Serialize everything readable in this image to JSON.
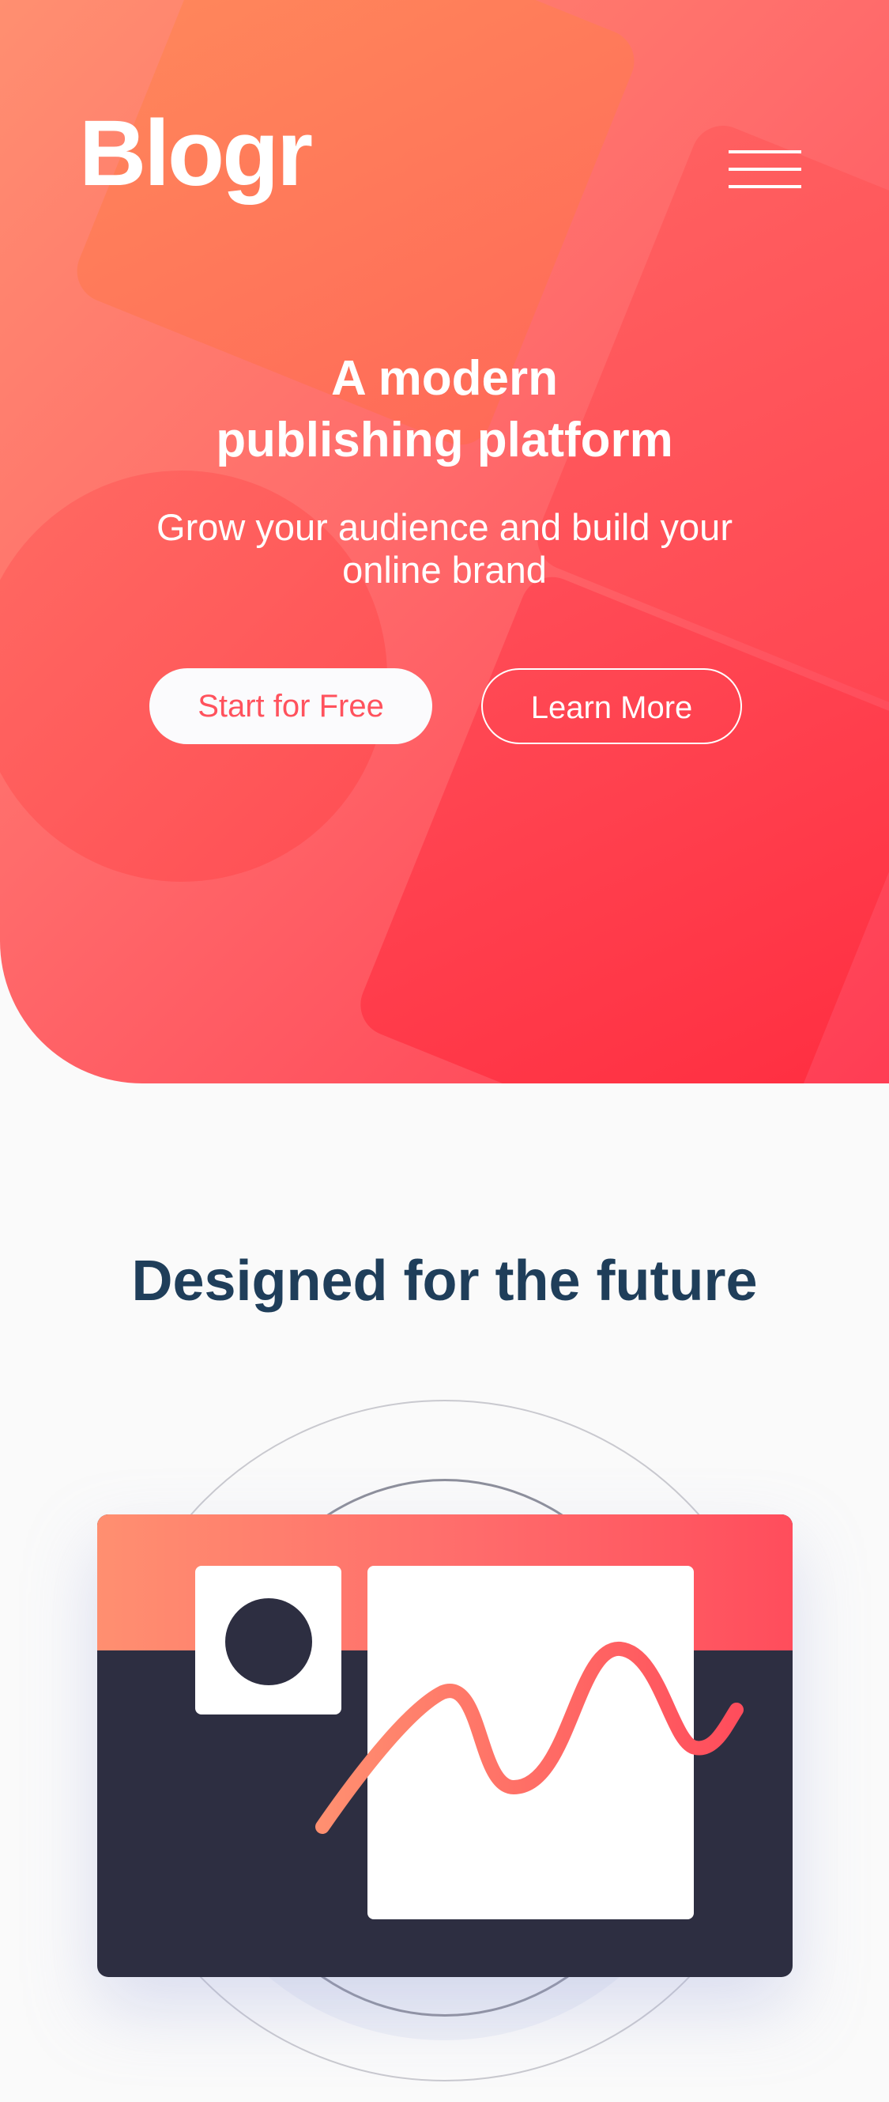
{
  "header": {
    "logo": "Blogr",
    "menu_icon": "hamburger-menu-icon"
  },
  "hero": {
    "title_line1": "A modern",
    "title_line2": "publishing platform",
    "subtitle_line1": "Grow your audience and build your",
    "subtitle_line2": "online brand",
    "primary_button": "Start for Free",
    "secondary_button": "Learn More"
  },
  "features": {
    "title": "Designed for the future",
    "illustration": "editor-window-illustration"
  },
  "colors": {
    "accent_light": "#ff8f70",
    "accent": "#ff525d",
    "accent_dark": "#ff3d54",
    "heading": "#1f3e5a",
    "window_dark": "#2d2e41"
  }
}
